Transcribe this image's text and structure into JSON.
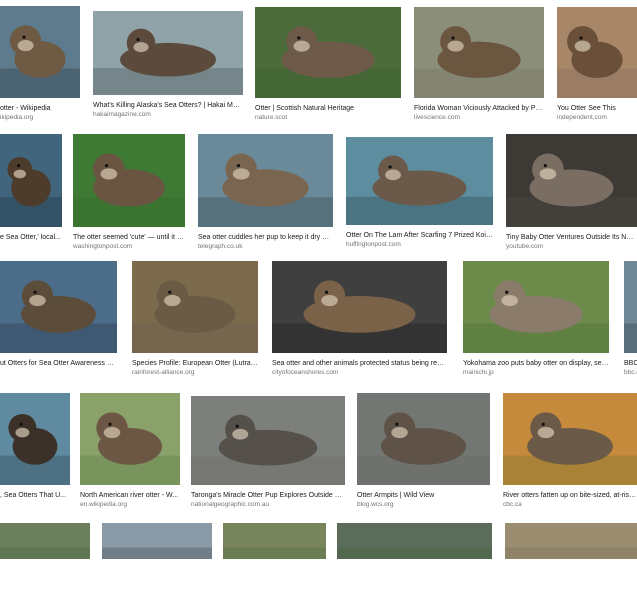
{
  "results": [
    {
      "title": "otter - Wikipedia",
      "source": "ikipedia.org",
      "bg": "#5d7b8c",
      "fg": "#6f5a43",
      "scene": "water"
    },
    {
      "title": "What's Killing Alaska's Sea Otters? | Hakai Mag...",
      "source": "hakaimagazine.com",
      "bg": "#8fa3a8",
      "fg": "#5c4a3c",
      "scene": "water"
    },
    {
      "title": "Otter | Scottish Natural Heritage",
      "source": "nature.scot",
      "bg": "#4b6b3a",
      "fg": "#6e5a49",
      "scene": "grass"
    },
    {
      "title": "Florida Woman Viciously Attacked by Pos...",
      "source": "livescience.com",
      "bg": "#8b8f79",
      "fg": "#6b5640",
      "scene": "rock"
    },
    {
      "title": "You Otter See This",
      "source": "independent.com",
      "bg": "#a88668",
      "fg": "#6a5038",
      "scene": "rock"
    },
    {
      "title": "e Sea Otter,' local...",
      "source": "",
      "bg": "#40657d",
      "fg": "#4d3b2c",
      "scene": "water"
    },
    {
      "title": "The otter seemed 'cute' — until it le...",
      "source": "washingtonpost.com",
      "bg": "#3f7a35",
      "fg": "#6a5442",
      "scene": "grass"
    },
    {
      "title": "Sea otter cuddles her pup to keep it dry an...",
      "source": "telegraph.co.uk",
      "bg": "#6b8a99",
      "fg": "#7a6650",
      "scene": "water"
    },
    {
      "title": "Otter On The Lam After Scarfing 7 Prized Koi F...",
      "source": "huffingtonpost.com",
      "bg": "#5c8ea0",
      "fg": "#6b5a4a",
      "scene": "water"
    },
    {
      "title": "Tiny Baby Otter Ventures Outside Its Nest: Zo...",
      "source": "youtube.com",
      "bg": "#3d3a36",
      "fg": "#7a6e62",
      "scene": "rock"
    },
    {
      "title": "ut Otters for Sea Otter Awareness We...",
      "source": "",
      "bg": "#4c6d8a",
      "fg": "#5c4c3a",
      "scene": "water"
    },
    {
      "title": "Species Profile: European Otter (Lutra l...",
      "source": "rainforest-alliance.org",
      "bg": "#7c6a4c",
      "fg": "#6b5a44",
      "scene": "rock"
    },
    {
      "title": "Sea otter and other animals protected status being review...",
      "source": "cityofoceanshores.com",
      "bg": "#3f3f3f",
      "fg": "#7a6248",
      "scene": "water"
    },
    {
      "title": "Yokohama zoo puts baby otter on display, seek...",
      "source": "mainichi.jp",
      "bg": "#6c8a4a",
      "fg": "#8a7b6a",
      "scene": "grass"
    },
    {
      "title": "BBC",
      "source": "bbc.c",
      "bg": "#6e8696",
      "fg": "#6e8696",
      "scene": "water"
    },
    {
      "title": ", Sea Otters That U...",
      "source": "",
      "bg": "#5f8aa0",
      "fg": "#3b3129",
      "scene": "water"
    },
    {
      "title": "North American river otter - W...",
      "source": "en.wikipedia.org",
      "bg": "#8aa16a",
      "fg": "#6b5743",
      "scene": "grass"
    },
    {
      "title": "Taronga's Miracle Otter Pup Explores Outside W...",
      "source": "nationalgeographic.com.au",
      "bg": "#7d7f7c",
      "fg": "#55504a",
      "scene": "rock"
    },
    {
      "title": "Otter Armpits | Wild View",
      "source": "blog.wcs.org",
      "bg": "#737774",
      "fg": "#5f5348",
      "scene": "rock"
    },
    {
      "title": "River otters fatten up on bite-sized, at-risk stu...",
      "source": "cbc.ca",
      "bg": "#c58a3c",
      "fg": "#6b5a48",
      "scene": "grass"
    },
    {
      "title": "",
      "source": "",
      "bg": "#6b7f5e",
      "fg": "#6b7f5e",
      "scene": "grass"
    },
    {
      "title": "",
      "source": "",
      "bg": "#8a9aa6",
      "fg": "#8a9aa6",
      "scene": "water"
    },
    {
      "title": "",
      "source": "",
      "bg": "#79865d",
      "fg": "#79865d",
      "scene": "grass"
    },
    {
      "title": "",
      "source": "",
      "bg": "#5b6c5a",
      "fg": "#5b6c5a",
      "scene": "grass"
    },
    {
      "title": "",
      "source": "",
      "bg": "#9a8d70",
      "fg": "#9a8d70",
      "scene": "rock"
    }
  ]
}
